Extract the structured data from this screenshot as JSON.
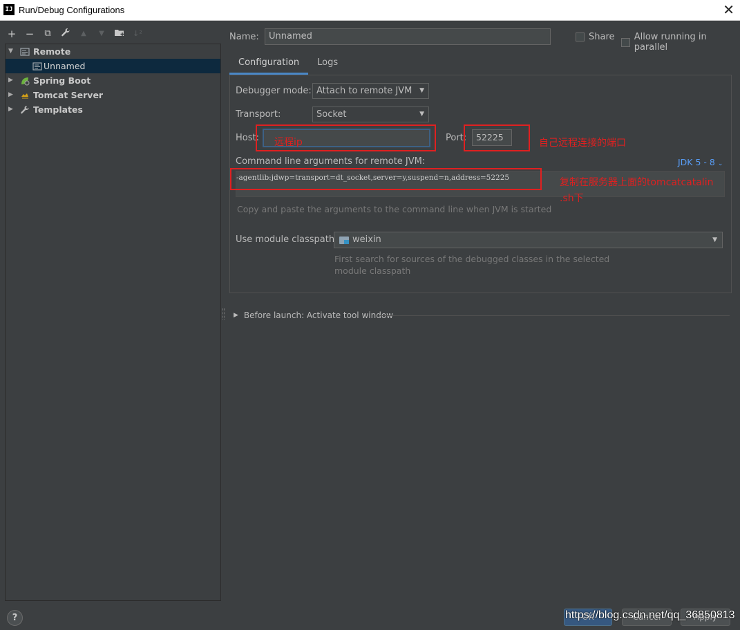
{
  "window": {
    "app_icon_text": "IJ",
    "title": "Run/Debug Configurations",
    "close_glyph": "✕"
  },
  "toolbar": {
    "add": "+",
    "remove": "−",
    "copy": "⧉",
    "edit_defaults": "🔧",
    "move_up": "▲",
    "move_down": "▼",
    "folder": "▤",
    "sort": "↓²"
  },
  "tree": {
    "items": [
      {
        "label": "Remote",
        "icon": "remote-icon",
        "expanded": true,
        "bold": true
      },
      {
        "label": "Unnamed",
        "icon": "remote-config-icon",
        "selected": true
      },
      {
        "label": "Spring Boot",
        "icon": "spring-boot-icon",
        "bold": true
      },
      {
        "label": "Tomcat Server",
        "icon": "tomcat-icon",
        "bold": true
      },
      {
        "label": "Templates",
        "icon": "wrench-icon",
        "bold": true
      }
    ]
  },
  "header": {
    "name_label": "Name:",
    "name_value": "Unnamed",
    "share_label": "Share",
    "parallel_label": "Allow running in parallel"
  },
  "tabs": [
    {
      "label": "Configuration",
      "active": true
    },
    {
      "label": "Logs",
      "active": false
    }
  ],
  "config": {
    "debugger_mode_label": "Debugger mode:",
    "debugger_mode_value": "Attach to remote JVM",
    "transport_label": "Transport:",
    "transport_value": "Socket",
    "host_label": "Host:",
    "host_value": "",
    "port_label": "Port:",
    "port_value": "52225",
    "cmd_label": "Command line arguments for remote JVM:",
    "jdk_link": "JDK 5 - 8",
    "cmd_value": "-agentlib:jdwp=transport=dt_socket,server=y,suspend=n,address=52225",
    "cmd_hint": "Copy and paste the arguments to the command line when JVM is started",
    "module_label": "Use module classpath:",
    "module_value": "weixin",
    "module_hint_line1": "First search for sources of the debugged classes in the selected",
    "module_hint_line2": "module classpath"
  },
  "before_launch": {
    "label": "Before launch: Activate tool window"
  },
  "annotations": {
    "host_note": "远程ip",
    "port_note": "自己远程连接的端口",
    "cmd_note_line1": "复制在服务器上面的tomcatcatalin",
    "cmd_note_line2": ".sh下",
    "color": "#e02020"
  },
  "footer": {
    "help": "?",
    "ok": "OK",
    "cancel": "Cancel",
    "apply": "Apply",
    "watermark": "https://blog.csdn.net/qq_36850813"
  },
  "colors": {
    "background": "#3c3f41",
    "selection": "#0d293e",
    "accent": "#4a88c7",
    "link": "#589df6"
  }
}
